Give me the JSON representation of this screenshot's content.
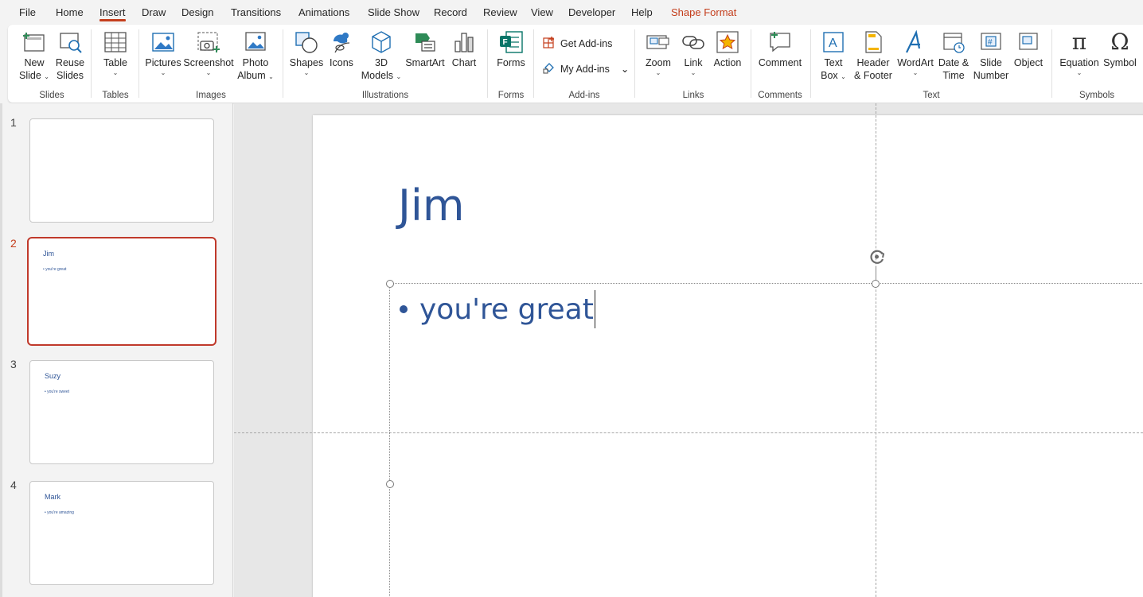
{
  "menu": {
    "tabs": [
      "File",
      "Home",
      "Insert",
      "Draw",
      "Design",
      "Transitions",
      "Animations",
      "Slide Show",
      "Record",
      "Review",
      "View",
      "Developer",
      "Help",
      "Shape Format"
    ],
    "active_tab": "Insert",
    "contextual_tab": "Shape Format"
  },
  "ribbon": {
    "slides": {
      "new_slide": "New Slide",
      "new_slide_l1": "New",
      "new_slide_l2": "Slide",
      "reuse_l1": "Reuse",
      "reuse_l2": "Slides",
      "group": "Slides"
    },
    "tables": {
      "table": "Table",
      "group": "Tables"
    },
    "images": {
      "pictures": "Pictures",
      "screenshot": "Screenshot",
      "photo_l1": "Photo",
      "photo_l2": "Album",
      "group": "Images"
    },
    "illustrations": {
      "shapes": "Shapes",
      "icons": "Icons",
      "models_l1": "3D",
      "models_l2": "Models",
      "smartart": "SmartArt",
      "chart": "Chart",
      "group": "Illustrations"
    },
    "forms": {
      "forms": "Forms",
      "group": "Forms"
    },
    "addins": {
      "get": "Get Add-ins",
      "my": "My Add-ins",
      "group": "Add-ins"
    },
    "links": {
      "zoom": "Zoom",
      "link": "Link",
      "action": "Action",
      "group": "Links"
    },
    "comments": {
      "comment": "Comment",
      "group": "Comments"
    },
    "text": {
      "textbox_l1": "Text",
      "textbox_l2": "Box",
      "hf_l1": "Header",
      "hf_l2": "& Footer",
      "wordart": "WordArt",
      "dt_l1": "Date &",
      "dt_l2": "Time",
      "sn_l1": "Slide",
      "sn_l2": "Number",
      "object": "Object",
      "group": "Text"
    },
    "symbols": {
      "equation": "Equation",
      "symbol": "Symbol",
      "group": "Symbols"
    }
  },
  "thumbnails": [
    {
      "number": "1",
      "title": "",
      "bullet": ""
    },
    {
      "number": "2",
      "title": "Jim",
      "bullet": "• you're great",
      "selected": true
    },
    {
      "number": "3",
      "title": "Suzy",
      "bullet": "• you're sweet"
    },
    {
      "number": "4",
      "title": "Mark",
      "bullet": "• you're amazing"
    }
  ],
  "current_slide": {
    "title": "Jim",
    "bullet_text": "you're great"
  },
  "colors": {
    "accent": "#c43e1c",
    "slide_text": "#2f5597"
  }
}
